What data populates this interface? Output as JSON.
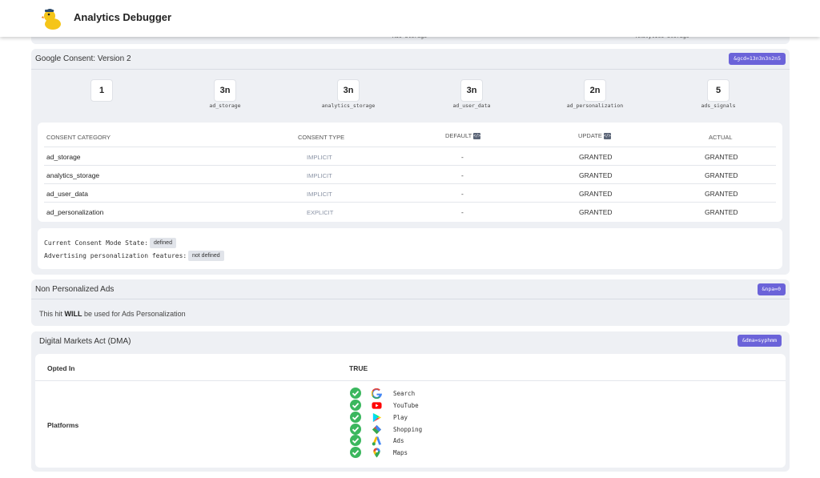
{
  "app": {
    "title": "Analytics Debugger"
  },
  "cut_panel": {
    "labels": [
      "Ads Storage",
      "Analytics Storage"
    ]
  },
  "consent": {
    "title": "Google Consent: Version 2",
    "badge": "&gcd=13n3n3n2n5",
    "summary": [
      {
        "value": "1",
        "label": ""
      },
      {
        "value": "3n",
        "label": "ad_storage"
      },
      {
        "value": "3n",
        "label": "analytics_storage"
      },
      {
        "value": "3n",
        "label": "ad_user_data"
      },
      {
        "value": "2n",
        "label": "ad_personalization"
      },
      {
        "value": "5",
        "label": "ads_signals"
      }
    ],
    "table": {
      "headers": [
        "CONSENT CATEGORY",
        "CONSENT TYPE",
        "DEFAULT",
        "UPDATE",
        "ACTUAL"
      ],
      "code_chip": "</>",
      "rows": [
        {
          "category": "ad_storage",
          "type": "IMPLICIT",
          "default": "-",
          "update": "GRANTED",
          "actual": "GRANTED"
        },
        {
          "category": "analytics_storage",
          "type": "IMPLICIT",
          "default": "-",
          "update": "GRANTED",
          "actual": "GRANTED"
        },
        {
          "category": "ad_user_data",
          "type": "IMPLICIT",
          "default": "-",
          "update": "GRANTED",
          "actual": "GRANTED"
        },
        {
          "category": "ad_personalization",
          "type": "EXPLICIT",
          "default": "-",
          "update": "GRANTED",
          "actual": "GRANTED"
        }
      ]
    },
    "state": {
      "mode_label": "Current Consent Mode State:",
      "mode_value": "defined",
      "features_label": "Advertising personalization features:",
      "features_value": "not defined"
    }
  },
  "npa": {
    "title": "Non Personalized Ads",
    "badge": "&npa=0",
    "text_before": "This hit ",
    "text_bold": "WILL",
    "text_after": " be used for Ads Personalization"
  },
  "dma": {
    "title": "Digital Markets Act (DMA)",
    "badge": "&dma=syphmm",
    "opted_in_label": "Opted In",
    "opted_in_value": "TRUE",
    "platforms_label": "Platforms",
    "platforms": [
      {
        "name": "Search",
        "icon": "google-icon"
      },
      {
        "name": "YouTube",
        "icon": "youtube-icon"
      },
      {
        "name": "Play",
        "icon": "google-play-icon"
      },
      {
        "name": "Shopping",
        "icon": "google-shopping-icon"
      },
      {
        "name": "Ads",
        "icon": "google-ads-icon"
      },
      {
        "name": "Maps",
        "icon": "google-maps-icon"
      }
    ]
  },
  "colors": {
    "accent": "#6b63d9",
    "panel": "#eef0f4",
    "check": "#3bb75e"
  }
}
